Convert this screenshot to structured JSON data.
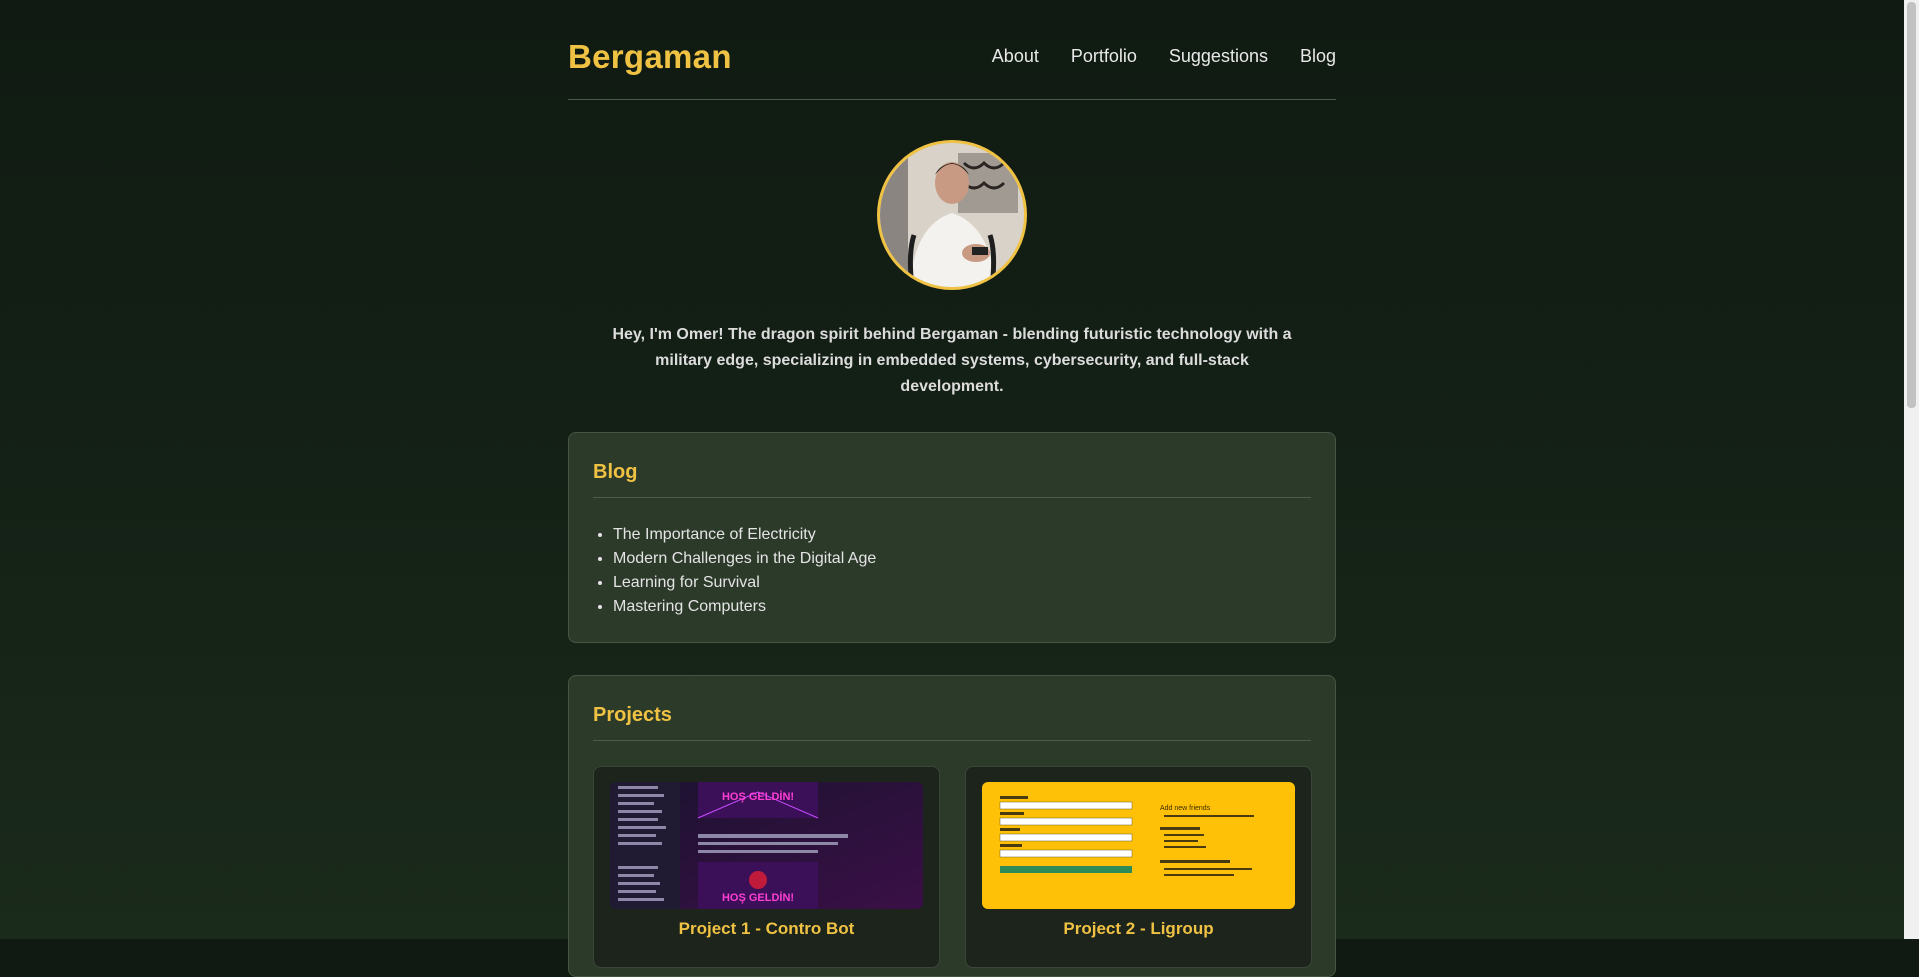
{
  "brand": {
    "name": "Bergaman",
    "accent": "#f0c243"
  },
  "nav": {
    "items": [
      "About",
      "Portfolio",
      "Suggestions",
      "Blog"
    ]
  },
  "profile": {
    "avatar_icon": "profile-photo",
    "intro": "Hey, I'm Omer! The dragon spirit behind Bergaman - blending futuristic technology with a military edge, specializing in embedded systems, cybersecurity, and full-stack development."
  },
  "blog": {
    "title": "Blog",
    "posts": [
      "The Importance of Electricity",
      "Modern Challenges in the Digital Age",
      "Learning for Survival",
      "Mastering Computers"
    ]
  },
  "projects": {
    "title": "Projects",
    "items": [
      {
        "title": "Project 1 - Contro Bot",
        "banner_text": "HOŞ GELDİN!"
      },
      {
        "title": "Project 2 - Ligroup",
        "thumb_heading": "Add new friends"
      }
    ]
  },
  "colors": {
    "background": "#121c14",
    "card": "#2c3a2a",
    "accent": "#f0c243"
  }
}
